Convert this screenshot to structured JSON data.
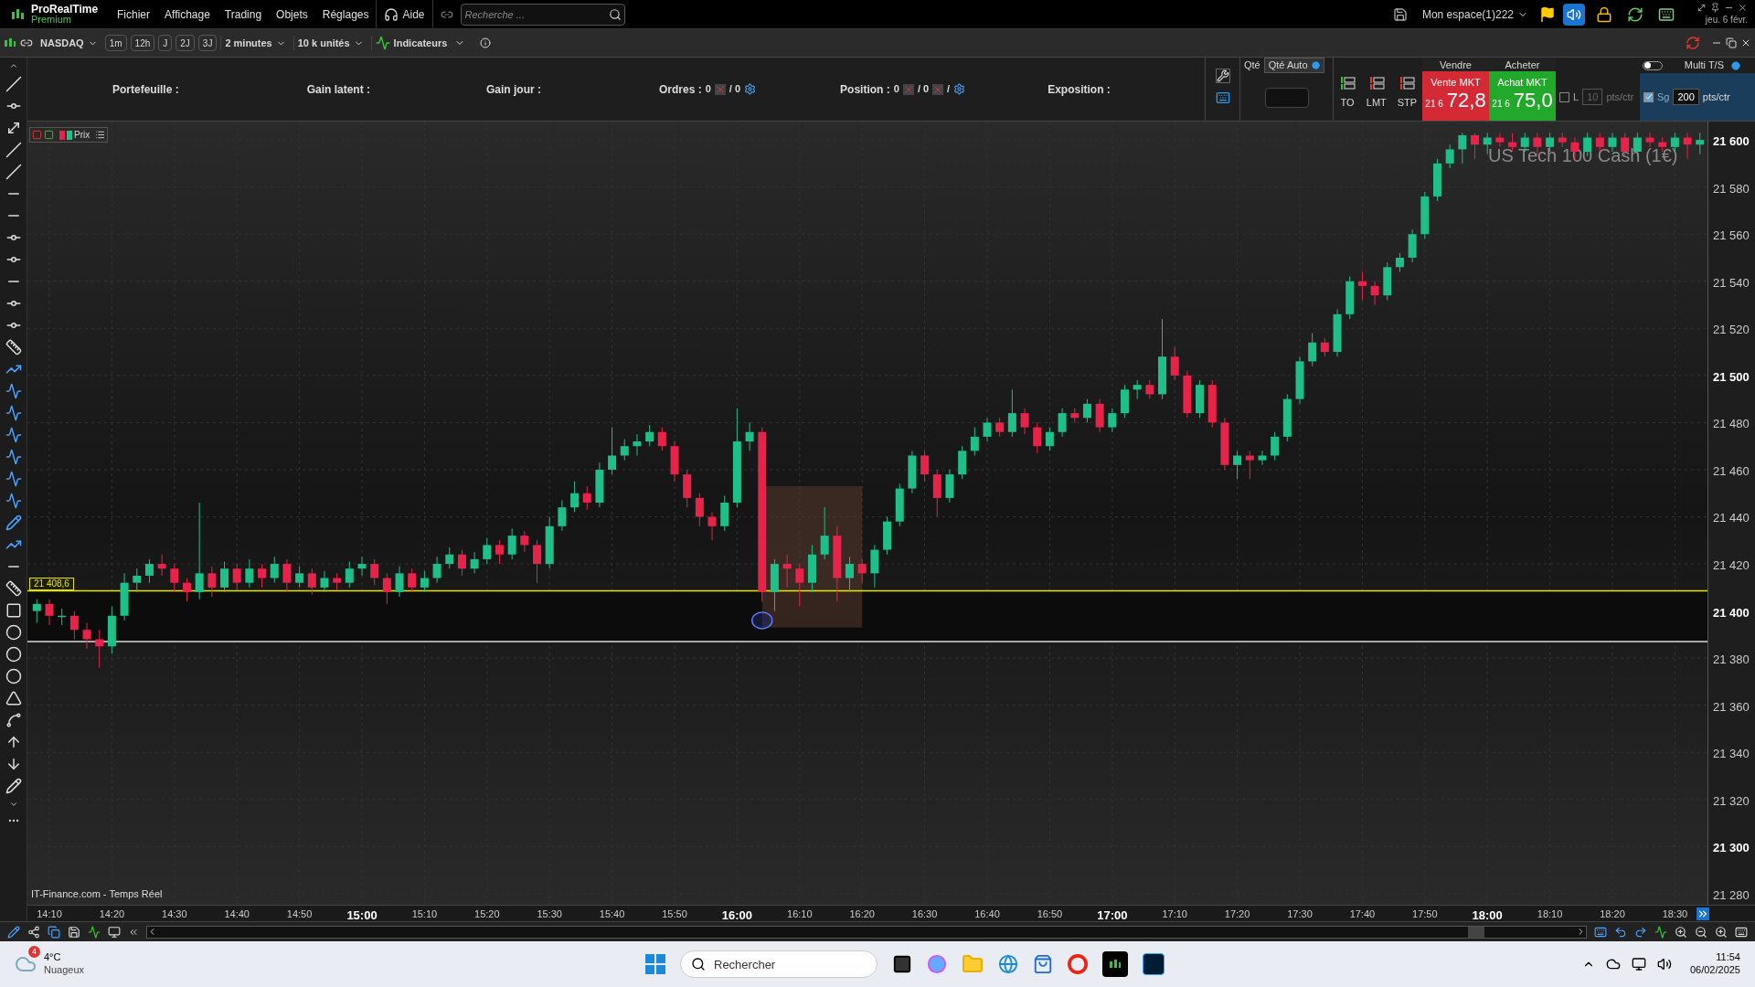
{
  "app": {
    "name": "ProRealTime",
    "edition": "Premium"
  },
  "menu": [
    "Fichier",
    "Affichage",
    "Trading",
    "Objets",
    "Réglages"
  ],
  "help": "Aide",
  "search": {
    "placeholder": "Recherche ..."
  },
  "workspace": "Mon espace(1)222",
  "date": "jeu. 6 févr.",
  "toolbar": {
    "instrument": "NASDAQ",
    "periods": [
      "1m",
      "12h",
      "J",
      "2J",
      "3J"
    ],
    "interval": "2 minutes",
    "units": "10 k unités",
    "indicators": "Indicateurs"
  },
  "account": {
    "portfolio": "Portefeuille :",
    "unrealized": "Gain latent :",
    "day_gain": "Gain jour :",
    "orders": {
      "label": "Ordres :",
      "count": "0",
      "total": "/ 0"
    },
    "position": {
      "label": "Position :",
      "count": "0",
      "total": "/ 0",
      "separator": "/"
    },
    "exposure": "Exposition :"
  },
  "quantity_tabs": [
    {
      "label": "Qté",
      "selected": false
    },
    {
      "label": "Qté Auto",
      "selected": true
    }
  ],
  "order_types": [
    "TO",
    "LMT",
    "STP"
  ],
  "sell": {
    "header": "Vendre",
    "button": "Vente MKT",
    "prefix": "21 6",
    "price": "72,8"
  },
  "buy": {
    "header": "Acheter",
    "button": "Achat MKT",
    "prefix": "21 6",
    "price": "75,0"
  },
  "limits": [
    {
      "label": "L",
      "checked": false,
      "value": "10",
      "unit": "pts/ctr"
    },
    {
      "label": "Sg",
      "checked": true,
      "value": "200",
      "unit": "pts/ctr"
    }
  ],
  "multi_ts": {
    "label": "Multi T/S",
    "on": false
  },
  "chart": {
    "legend": "Prix",
    "watermark": "US Tech 100 Cash (1€)",
    "source": "IT-Finance.com - Temps Réel",
    "ytick_bold": [
      true,
      false,
      false,
      false,
      false,
      true,
      false,
      false,
      false,
      false,
      true,
      false,
      false,
      false,
      false,
      true,
      false
    ],
    "xtick_bold": [
      false,
      false,
      false,
      false,
      false,
      true,
      false,
      false,
      false,
      false,
      false,
      true,
      false,
      false,
      false,
      false,
      false,
      true,
      false,
      false,
      false,
      false,
      false,
      true,
      false,
      false,
      false
    ],
    "chart_data": {
      "type": "candlestick",
      "ylim": [
        21275.3,
        21607.8
      ],
      "grid": true,
      "yticks": [
        {
          "value": 21600,
          "label": "21 600"
        },
        {
          "value": 21580,
          "label": "21 580"
        },
        {
          "value": 21560,
          "label": "21 560"
        },
        {
          "value": 21540,
          "label": "21 540"
        },
        {
          "value": 21520,
          "label": "21 520"
        },
        {
          "value": 21500,
          "label": "21 500"
        },
        {
          "value": 21480,
          "label": "21 480"
        },
        {
          "value": 21460,
          "label": "21 460"
        },
        {
          "value": 21440,
          "label": "21 440"
        },
        {
          "value": 21420,
          "label": "21 420"
        },
        {
          "value": 21400,
          "label": "21 400"
        },
        {
          "value": 21380,
          "label": "21 380"
        },
        {
          "value": 21360,
          "label": "21 360"
        },
        {
          "value": 21340,
          "label": "21 340"
        },
        {
          "value": 21320,
          "label": "21 320"
        },
        {
          "value": 21300,
          "label": "21 300"
        },
        {
          "value": 21280,
          "label": "21 280"
        }
      ],
      "categories": [
        null,
        "14:10",
        null,
        null,
        null,
        null,
        "14:20",
        null,
        null,
        null,
        null,
        "14:30",
        null,
        null,
        null,
        null,
        "14:40",
        null,
        null,
        null,
        null,
        "14:50",
        null,
        null,
        null,
        null,
        "15:00",
        null,
        null,
        null,
        null,
        "15:10",
        null,
        null,
        null,
        null,
        "15:20",
        null,
        null,
        null,
        null,
        "15:30",
        null,
        null,
        null,
        null,
        "15:40",
        null,
        null,
        null,
        null,
        "15:50",
        null,
        null,
        null,
        null,
        "16:00",
        null,
        null,
        null,
        null,
        "16:10",
        null,
        null,
        null,
        null,
        "16:20",
        null,
        null,
        null,
        null,
        "16:30",
        null,
        null,
        null,
        null,
        "16:40",
        null,
        null,
        null,
        null,
        "16:50",
        null,
        null,
        null,
        null,
        "17:00",
        null,
        null,
        null,
        null,
        "17:10",
        null,
        null,
        null,
        null,
        "17:20",
        null,
        null,
        null,
        null,
        "17:30",
        null,
        null,
        null,
        null,
        "17:40",
        null,
        null,
        null,
        null,
        "17:50",
        null,
        null,
        null,
        null,
        "18:00",
        null,
        null,
        null,
        null,
        "18:10",
        null,
        null,
        null,
        null,
        "18:20",
        null,
        null,
        null,
        null,
        "18:30",
        null,
        null
      ],
      "ref_lines": [
        {
          "axis": "y",
          "value": 21408.6,
          "color": "#e6e600",
          "label": "21 408,6"
        },
        {
          "axis": "y",
          "value": 21387,
          "color": "#dddddd"
        }
      ],
      "bands": [
        {
          "axis": "y",
          "from": 21387,
          "to": 21408.6,
          "color": "#0c0c0c"
        }
      ],
      "ohlc": [
        [
          21400,
          21405,
          21395,
          21403
        ],
        [
          21403,
          21405,
          21394,
          21398
        ],
        [
          21398,
          21401,
          21394,
          21398
        ],
        [
          21398,
          21400,
          21388,
          21392
        ],
        [
          21392,
          21395,
          21384,
          21388
        ],
        [
          21388,
          21392,
          21376,
          21385
        ],
        [
          21385,
          21402,
          21382,
          21398
        ],
        [
          21398,
          21416,
          21396,
          21412
        ],
        [
          21412,
          21418,
          21408,
          21415
        ],
        [
          21415,
          21422,
          21412,
          21420
        ],
        [
          21420,
          21424,
          21415,
          21418
        ],
        [
          21418,
          21420,
          21408,
          21412
        ],
        [
          21412,
          21414,
          21404,
          21408
        ],
        [
          21408,
          21446,
          21405,
          21416
        ],
        [
          21416,
          21419,
          21406,
          21410
        ],
        [
          21410,
          21421,
          21408,
          21418
        ],
        [
          21418,
          21420,
          21409,
          21412
        ],
        [
          21412,
          21422,
          21410,
          21418
        ],
        [
          21418,
          21420,
          21410,
          21414
        ],
        [
          21414,
          21423,
          21412,
          21420
        ],
        [
          21420,
          21422,
          21408,
          21412
        ],
        [
          21412,
          21419,
          21410,
          21416
        ],
        [
          21416,
          21418,
          21407,
          21410
        ],
        [
          21410,
          21417,
          21408,
          21414
        ],
        [
          21414,
          21416,
          21409,
          21412
        ],
        [
          21412,
          21421,
          21410,
          21418
        ],
        [
          21418,
          21423,
          21415,
          21420
        ],
        [
          21420,
          21422,
          21411,
          21414
        ],
        [
          21414,
          21416,
          21403,
          21408
        ],
        [
          21408,
          21419,
          21406,
          21416
        ],
        [
          21416,
          21418,
          21408,
          21410
        ],
        [
          21410,
          21417,
          21408,
          21414
        ],
        [
          21414,
          21423,
          21412,
          21420
        ],
        [
          21420,
          21427,
          21418,
          21424
        ],
        [
          21424,
          21426,
          21415,
          21418
        ],
        [
          21418,
          21425,
          21416,
          21422
        ],
        [
          21422,
          21431,
          21420,
          21428
        ],
        [
          21428,
          21430,
          21420,
          21424
        ],
        [
          21424,
          21435,
          21422,
          21432
        ],
        [
          21432,
          21434,
          21425,
          21428
        ],
        [
          21428,
          21430,
          21412,
          21420
        ],
        [
          21420,
          21440,
          21418,
          21436
        ],
        [
          21436,
          21447,
          21434,
          21444
        ],
        [
          21444,
          21455,
          21442,
          21450
        ],
        [
          21450,
          21453,
          21443,
          21446
        ],
        [
          21446,
          21463,
          21444,
          21460
        ],
        [
          21460,
          21478,
          21458,
          21466
        ],
        [
          21466,
          21473,
          21464,
          21470
        ],
        [
          21470,
          21475,
          21466,
          21472
        ],
        [
          21472,
          21479,
          21470,
          21476
        ],
        [
          21476,
          21478,
          21468,
          21470
        ],
        [
          21470,
          21472,
          21455,
          21458
        ],
        [
          21458,
          21460,
          21444,
          21448
        ],
        [
          21448,
          21450,
          21436,
          21440
        ],
        [
          21440,
          21442,
          21430,
          21436
        ],
        [
          21436,
          21449,
          21434,
          21446
        ],
        [
          21446,
          21486,
          21444,
          21472
        ],
        [
          21472,
          21480,
          21468,
          21476
        ],
        [
          21476,
          21478,
          21404,
          21408
        ],
        [
          21408,
          21422,
          21400,
          21420
        ],
        [
          21420,
          21424,
          21410,
          21418
        ],
        [
          21418,
          21420,
          21402,
          21412
        ],
        [
          21412,
          21428,
          21408,
          21424
        ],
        [
          21424,
          21444,
          21422,
          21432
        ],
        [
          21432,
          21436,
          21404,
          21414
        ],
        [
          21414,
          21423,
          21408,
          21420
        ],
        [
          21420,
          21422,
          21412,
          21416
        ],
        [
          21416,
          21428,
          21410,
          21426
        ],
        [
          21426,
          21440,
          21424,
          21438
        ],
        [
          21438,
          21454,
          21436,
          21452
        ],
        [
          21452,
          21468,
          21450,
          21466
        ],
        [
          21466,
          21468,
          21455,
          21458
        ],
        [
          21458,
          21460,
          21440,
          21448
        ],
        [
          21448,
          21460,
          21446,
          21458
        ],
        [
          21458,
          21470,
          21456,
          21468
        ],
        [
          21468,
          21478,
          21466,
          21474
        ],
        [
          21474,
          21482,
          21472,
          21480
        ],
        [
          21480,
          21482,
          21474,
          21476
        ],
        [
          21476,
          21494,
          21474,
          21484
        ],
        [
          21484,
          21486,
          21475,
          21478
        ],
        [
          21478,
          21480,
          21467,
          21470
        ],
        [
          21470,
          21478,
          21468,
          21476
        ],
        [
          21476,
          21486,
          21474,
          21484
        ],
        [
          21484,
          21486,
          21480,
          21482
        ],
        [
          21482,
          21490,
          21480,
          21488
        ],
        [
          21488,
          21490,
          21476,
          21478
        ],
        [
          21478,
          21486,
          21476,
          21484
        ],
        [
          21484,
          21496,
          21482,
          21494
        ],
        [
          21494,
          21498,
          21490,
          21496
        ],
        [
          21496,
          21498,
          21490,
          21492
        ],
        [
          21492,
          21524,
          21490,
          21508
        ],
        [
          21508,
          21512,
          21498,
          21500
        ],
        [
          21500,
          21502,
          21482,
          21484
        ],
        [
          21484,
          21498,
          21482,
          21496
        ],
        [
          21496,
          21498,
          21478,
          21480
        ],
        [
          21480,
          21482,
          21460,
          21462
        ],
        [
          21462,
          21468,
          21456,
          21466
        ],
        [
          21466,
          21468,
          21456,
          21464
        ],
        [
          21464,
          21468,
          21462,
          21466
        ],
        [
          21466,
          21476,
          21464,
          21474
        ],
        [
          21474,
          21492,
          21472,
          21490
        ],
        [
          21490,
          21508,
          21488,
          21506
        ],
        [
          21506,
          21518,
          21504,
          21514
        ],
        [
          21514,
          21516,
          21508,
          21510
        ],
        [
          21510,
          21528,
          21508,
          21526
        ],
        [
          21526,
          21542,
          21524,
          21540
        ],
        [
          21540,
          21544,
          21532,
          21538
        ],
        [
          21538,
          21540,
          21530,
          21534
        ],
        [
          21534,
          21548,
          21532,
          21546
        ],
        [
          21546,
          21552,
          21544,
          21550
        ],
        [
          21550,
          21562,
          21548,
          21560
        ],
        [
          21560,
          21578,
          21558,
          21576
        ],
        [
          21576,
          21592,
          21574,
          21590
        ],
        [
          21590,
          21598,
          21588,
          21596
        ],
        [
          21596,
          21603,
          21590,
          21602
        ],
        [
          21602,
          21603,
          21592,
          21598
        ],
        [
          21598,
          21603,
          21594,
          21601
        ],
        [
          21601,
          21603,
          21597,
          21599
        ],
        [
          21599,
          21603,
          21595,
          21597
        ],
        [
          21597,
          21603,
          21595,
          21601
        ],
        [
          21601,
          21603,
          21593,
          21597
        ],
        [
          21597,
          21603,
          21595,
          21601
        ],
        [
          21601,
          21603,
          21597,
          21599
        ],
        [
          21599,
          21601,
          21591,
          21595
        ],
        [
          21595,
          21603,
          21593,
          21601
        ],
        [
          21601,
          21603,
          21595,
          21597
        ],
        [
          21597,
          21603,
          21595,
          21601
        ],
        [
          21601,
          21603,
          21593,
          21595
        ],
        [
          21595,
          21603,
          21593,
          21601
        ],
        [
          21601,
          21603,
          21597,
          21599
        ],
        [
          21599,
          21601,
          21595,
          21597
        ],
        [
          21597,
          21603,
          21595,
          21601
        ],
        [
          21601,
          21603,
          21592,
          21598
        ],
        [
          21598,
          21603,
          21594,
          21600
        ]
      ]
    }
  },
  "taskbar": {
    "weather": {
      "badge": "4",
      "temperature": "4°C",
      "condition": "Nuageux"
    },
    "search": {
      "placeholder": "Rechercher"
    },
    "time": "11:54",
    "date": "06/02/2025"
  }
}
